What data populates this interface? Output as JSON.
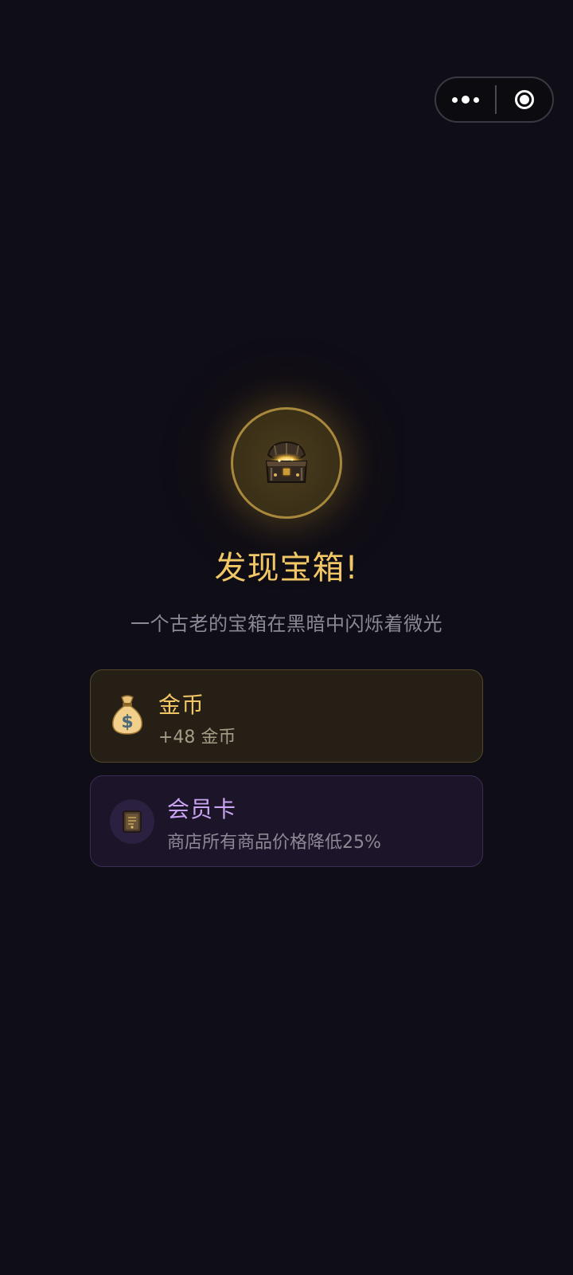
{
  "capsule": {
    "more_icon": "more-dots-icon",
    "close_icon": "target-close-icon"
  },
  "discovery": {
    "icon": "treasure-chest-icon",
    "title": "发现宝箱!",
    "subtitle": "一个古老的宝箱在黑暗中闪烁着微光"
  },
  "rewards": [
    {
      "icon": "money-bag-icon",
      "title": "金币",
      "description": "+48 金币",
      "accent": "#f1c766"
    },
    {
      "icon": "member-card-icon",
      "title": "会员卡",
      "description": "商店所有商品价格降低25%",
      "accent": "#c9a4f2"
    }
  ],
  "colors": {
    "background": "#0f0d16",
    "gold": "#f1c766",
    "purple": "#c9a4f2"
  }
}
